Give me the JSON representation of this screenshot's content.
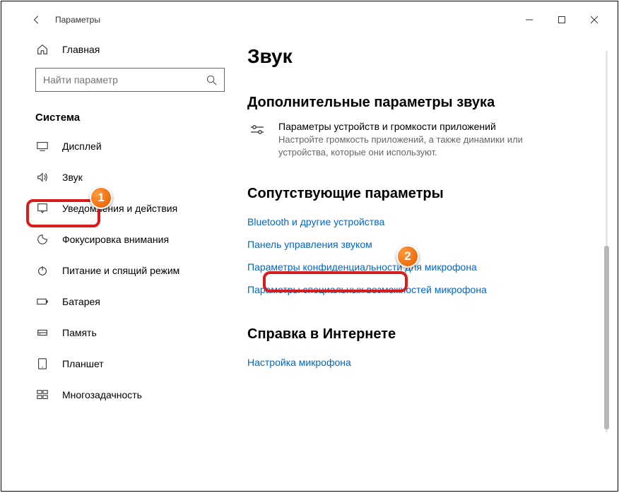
{
  "window": {
    "title": "Параметры"
  },
  "sidebar": {
    "home": "Главная",
    "search_placeholder": "Найти параметр",
    "category": "Система",
    "items": [
      {
        "icon": "display-icon",
        "label": "Дисплей"
      },
      {
        "icon": "sound-icon",
        "label": "Звук"
      },
      {
        "icon": "notify-icon",
        "label": "Уведомления и действия"
      },
      {
        "icon": "focus-icon",
        "label": "Фокусировка внимания"
      },
      {
        "icon": "power-icon",
        "label": "Питание и спящий режим"
      },
      {
        "icon": "battery-icon",
        "label": "Батарея"
      },
      {
        "icon": "storage-icon",
        "label": "Память"
      },
      {
        "icon": "tablet-icon",
        "label": "Планшет"
      },
      {
        "icon": "multitask-icon",
        "label": "Многозадачность"
      }
    ]
  },
  "main": {
    "title": "Звук",
    "advanced": {
      "heading": "Дополнительные параметры звука",
      "item_title": "Параметры устройств и громкости приложений",
      "item_desc": "Настройте громкость приложений, а также динамики или устройства, которые они используют."
    },
    "related": {
      "heading": "Сопутствующие параметры",
      "links": [
        "Bluetooth и другие устройства",
        "Панель управления звуком",
        "Параметры конфиденциальности для микрофона",
        "Параметры специальных возможностей микрофона"
      ]
    },
    "help": {
      "heading": "Справка в Интернете",
      "links": [
        "Настройка микрофона"
      ]
    }
  },
  "annotations": {
    "badge1": "1",
    "badge2": "2"
  }
}
